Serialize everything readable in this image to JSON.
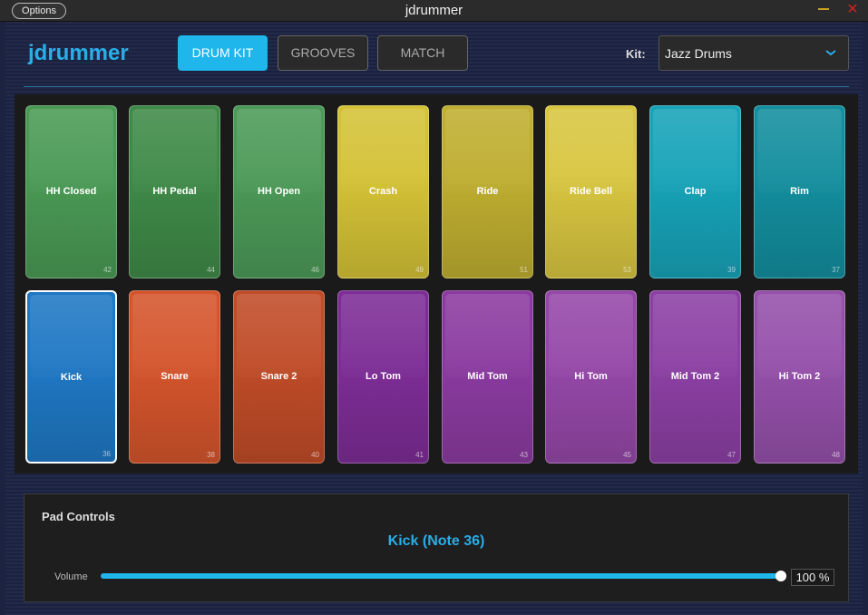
{
  "window": {
    "title": "jdrummer",
    "options_label": "Options"
  },
  "header": {
    "logo": "jdrummer",
    "tabs": [
      {
        "label": "DRUM KIT",
        "active": true
      },
      {
        "label": "GROOVES",
        "active": false
      },
      {
        "label": "MATCH",
        "active": false
      }
    ],
    "kit_label": "Kit:",
    "kit_value": "Jazz Drums"
  },
  "pads": [
    {
      "name": "HH Closed",
      "note": "42",
      "color": "#4a9a55"
    },
    {
      "name": "HH Pedal",
      "note": "44",
      "color": "#3f8a48"
    },
    {
      "name": "HH Open",
      "note": "46",
      "color": "#4c9a58"
    },
    {
      "name": "Crash",
      "note": "49",
      "color": "#d4c236"
    },
    {
      "name": "Ride",
      "note": "51",
      "color": "#bfae30"
    },
    {
      "name": "Ride Bell",
      "note": "53",
      "color": "#d8c640"
    },
    {
      "name": "Clap",
      "note": "39",
      "color": "#17a3b8"
    },
    {
      "name": "Rim",
      "note": "37",
      "color": "#138e9e"
    },
    {
      "name": "Kick",
      "note": "36",
      "color": "#1f78c4",
      "selected": true
    },
    {
      "name": "Snare",
      "note": "38",
      "color": "#d4552c"
    },
    {
      "name": "Snare 2",
      "note": "40",
      "color": "#c04c28"
    },
    {
      "name": "Lo Tom",
      "note": "41",
      "color": "#7d2d96"
    },
    {
      "name": "Mid Tom",
      "note": "43",
      "color": "#8b3ba0"
    },
    {
      "name": "Hi Tom",
      "note": "45",
      "color": "#9548a8"
    },
    {
      "name": "Mid Tom 2",
      "note": "47",
      "color": "#8c40a4"
    },
    {
      "name": "Hi Tom 2",
      "note": "48",
      "color": "#9550aa"
    }
  ],
  "controls": {
    "title": "Pad Controls",
    "selected_pad": "Kick (Note 36)",
    "volume_label": "Volume",
    "volume_value": "100 %",
    "volume_level": 1.0
  }
}
